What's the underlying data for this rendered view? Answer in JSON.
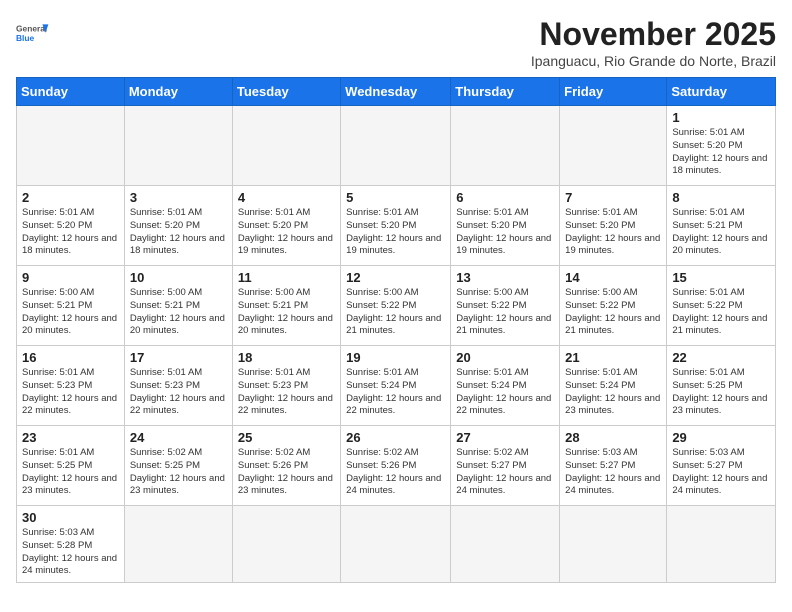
{
  "header": {
    "logo_general": "General",
    "logo_blue": "Blue",
    "month_year": "November 2025",
    "location": "Ipanguacu, Rio Grande do Norte, Brazil"
  },
  "days_of_week": [
    "Sunday",
    "Monday",
    "Tuesday",
    "Wednesday",
    "Thursday",
    "Friday",
    "Saturday"
  ],
  "weeks": [
    [
      {
        "day": "",
        "info": ""
      },
      {
        "day": "",
        "info": ""
      },
      {
        "day": "",
        "info": ""
      },
      {
        "day": "",
        "info": ""
      },
      {
        "day": "",
        "info": ""
      },
      {
        "day": "",
        "info": ""
      },
      {
        "day": "1",
        "info": "Sunrise: 5:01 AM\nSunset: 5:20 PM\nDaylight: 12 hours and 18 minutes."
      }
    ],
    [
      {
        "day": "2",
        "info": "Sunrise: 5:01 AM\nSunset: 5:20 PM\nDaylight: 12 hours and 18 minutes."
      },
      {
        "day": "3",
        "info": "Sunrise: 5:01 AM\nSunset: 5:20 PM\nDaylight: 12 hours and 18 minutes."
      },
      {
        "day": "4",
        "info": "Sunrise: 5:01 AM\nSunset: 5:20 PM\nDaylight: 12 hours and 19 minutes."
      },
      {
        "day": "5",
        "info": "Sunrise: 5:01 AM\nSunset: 5:20 PM\nDaylight: 12 hours and 19 minutes."
      },
      {
        "day": "6",
        "info": "Sunrise: 5:01 AM\nSunset: 5:20 PM\nDaylight: 12 hours and 19 minutes."
      },
      {
        "day": "7",
        "info": "Sunrise: 5:01 AM\nSunset: 5:20 PM\nDaylight: 12 hours and 19 minutes."
      },
      {
        "day": "8",
        "info": "Sunrise: 5:01 AM\nSunset: 5:21 PM\nDaylight: 12 hours and 20 minutes."
      }
    ],
    [
      {
        "day": "9",
        "info": "Sunrise: 5:00 AM\nSunset: 5:21 PM\nDaylight: 12 hours and 20 minutes."
      },
      {
        "day": "10",
        "info": "Sunrise: 5:00 AM\nSunset: 5:21 PM\nDaylight: 12 hours and 20 minutes."
      },
      {
        "day": "11",
        "info": "Sunrise: 5:00 AM\nSunset: 5:21 PM\nDaylight: 12 hours and 20 minutes."
      },
      {
        "day": "12",
        "info": "Sunrise: 5:00 AM\nSunset: 5:22 PM\nDaylight: 12 hours and 21 minutes."
      },
      {
        "day": "13",
        "info": "Sunrise: 5:00 AM\nSunset: 5:22 PM\nDaylight: 12 hours and 21 minutes."
      },
      {
        "day": "14",
        "info": "Sunrise: 5:00 AM\nSunset: 5:22 PM\nDaylight: 12 hours and 21 minutes."
      },
      {
        "day": "15",
        "info": "Sunrise: 5:01 AM\nSunset: 5:22 PM\nDaylight: 12 hours and 21 minutes."
      }
    ],
    [
      {
        "day": "16",
        "info": "Sunrise: 5:01 AM\nSunset: 5:23 PM\nDaylight: 12 hours and 22 minutes."
      },
      {
        "day": "17",
        "info": "Sunrise: 5:01 AM\nSunset: 5:23 PM\nDaylight: 12 hours and 22 minutes."
      },
      {
        "day": "18",
        "info": "Sunrise: 5:01 AM\nSunset: 5:23 PM\nDaylight: 12 hours and 22 minutes."
      },
      {
        "day": "19",
        "info": "Sunrise: 5:01 AM\nSunset: 5:24 PM\nDaylight: 12 hours and 22 minutes."
      },
      {
        "day": "20",
        "info": "Sunrise: 5:01 AM\nSunset: 5:24 PM\nDaylight: 12 hours and 22 minutes."
      },
      {
        "day": "21",
        "info": "Sunrise: 5:01 AM\nSunset: 5:24 PM\nDaylight: 12 hours and 23 minutes."
      },
      {
        "day": "22",
        "info": "Sunrise: 5:01 AM\nSunset: 5:25 PM\nDaylight: 12 hours and 23 minutes."
      }
    ],
    [
      {
        "day": "23",
        "info": "Sunrise: 5:01 AM\nSunset: 5:25 PM\nDaylight: 12 hours and 23 minutes."
      },
      {
        "day": "24",
        "info": "Sunrise: 5:02 AM\nSunset: 5:25 PM\nDaylight: 12 hours and 23 minutes."
      },
      {
        "day": "25",
        "info": "Sunrise: 5:02 AM\nSunset: 5:26 PM\nDaylight: 12 hours and 23 minutes."
      },
      {
        "day": "26",
        "info": "Sunrise: 5:02 AM\nSunset: 5:26 PM\nDaylight: 12 hours and 24 minutes."
      },
      {
        "day": "27",
        "info": "Sunrise: 5:02 AM\nSunset: 5:27 PM\nDaylight: 12 hours and 24 minutes."
      },
      {
        "day": "28",
        "info": "Sunrise: 5:03 AM\nSunset: 5:27 PM\nDaylight: 12 hours and 24 minutes."
      },
      {
        "day": "29",
        "info": "Sunrise: 5:03 AM\nSunset: 5:27 PM\nDaylight: 12 hours and 24 minutes."
      }
    ],
    [
      {
        "day": "30",
        "info": "Sunrise: 5:03 AM\nSunset: 5:28 PM\nDaylight: 12 hours and 24 minutes."
      },
      {
        "day": "",
        "info": ""
      },
      {
        "day": "",
        "info": ""
      },
      {
        "day": "",
        "info": ""
      },
      {
        "day": "",
        "info": ""
      },
      {
        "day": "",
        "info": ""
      },
      {
        "day": "",
        "info": ""
      }
    ]
  ]
}
